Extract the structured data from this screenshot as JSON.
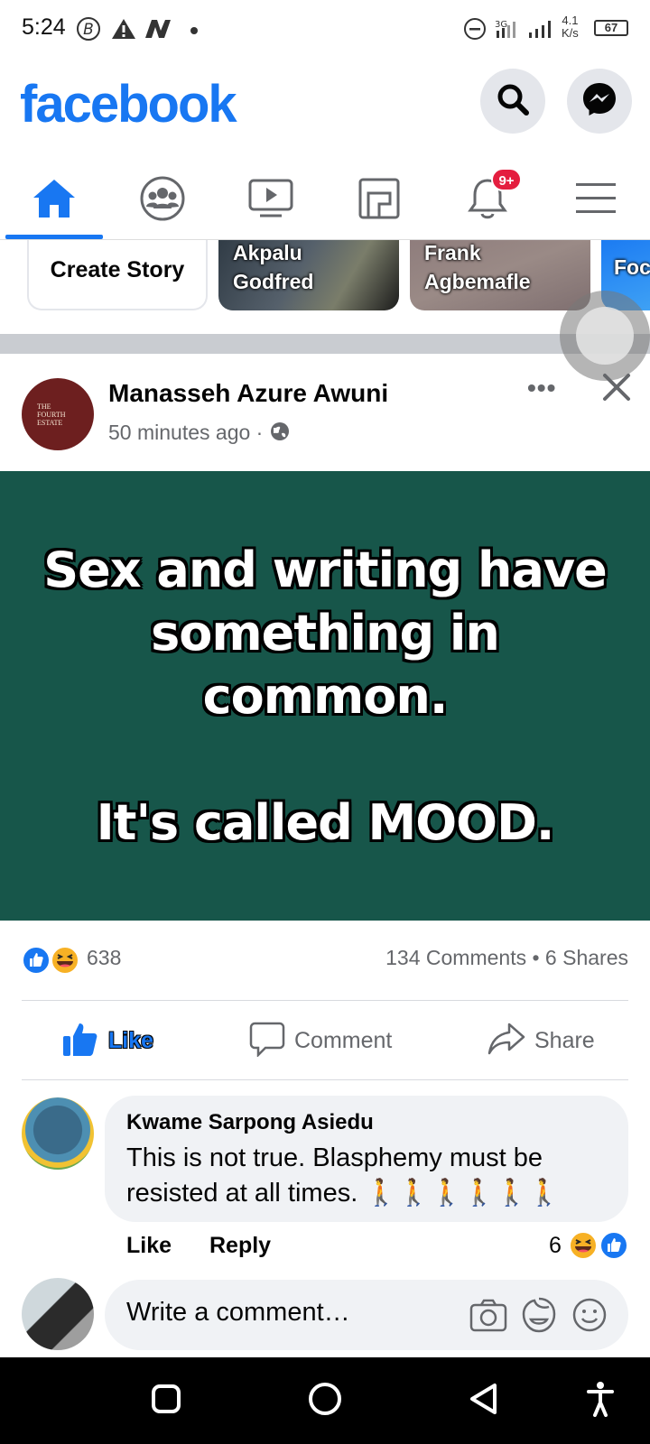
{
  "status_bar": {
    "time": "5:24",
    "network_speed_value": "4.1",
    "network_speed_unit": "K/s",
    "battery": "67",
    "icons": [
      "bitcoin-icon",
      "warning-icon",
      "n-icon",
      "dot-icon",
      "dnd-icon",
      "signal-3g-icon",
      "signal-icon"
    ]
  },
  "header": {
    "logo": "facebook",
    "brand_color": "#1877f2",
    "search_icon": "search-icon",
    "messenger_icon": "messenger-icon"
  },
  "nav": {
    "tabs": [
      {
        "name": "home",
        "icon": "home-icon",
        "active": true
      },
      {
        "name": "groups",
        "icon": "groups-icon"
      },
      {
        "name": "watch",
        "icon": "video-icon"
      },
      {
        "name": "marketplace",
        "icon": "marketplace-icon"
      },
      {
        "name": "notifications",
        "icon": "bell-icon",
        "badge": "9+"
      },
      {
        "name": "menu",
        "icon": "menu-icon"
      }
    ]
  },
  "stories": {
    "create_label": "Create Story",
    "items": [
      {
        "name_line1": "Akpalu",
        "name_line2": "Godfred"
      },
      {
        "name_line1": "Frank",
        "name_line2": "Agbemafle"
      },
      {
        "name_line1": "Foc",
        "name_line2": ""
      }
    ]
  },
  "post": {
    "avatar_text": "THE FOURTH ESTATE",
    "author": "Manasseh Azure Awuni",
    "time": "50 minutes ago",
    "time_separator": "·",
    "more": "•••",
    "background_color": "#17564a",
    "lines": [
      "Sex and writing have",
      "something in",
      "common.",
      "It's called MOOD."
    ],
    "reaction_count": "638",
    "comments_shares": "134 Comments • 6 Shares",
    "actions": {
      "like": "Like",
      "comment": "Comment",
      "share": "Share"
    }
  },
  "comment": {
    "author": "Kwame Sarpong Asiedu",
    "text": "This is not true. Blasphemy must be resisted at all times. 🚶🚶🚶🚶🚶🚶",
    "like": "Like",
    "reply": "Reply",
    "reaction_count": "6"
  },
  "write_comment": {
    "placeholder": "Write a comment…"
  }
}
